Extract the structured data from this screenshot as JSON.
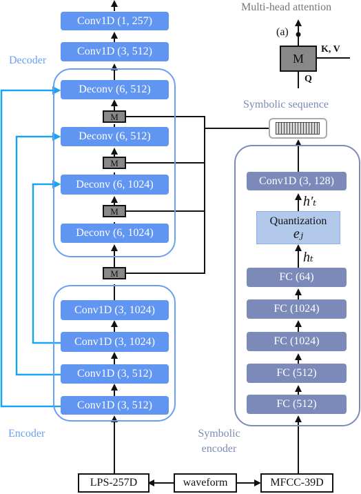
{
  "title": "Multi-head attention",
  "legend": {
    "title": "Multi-head attention",
    "label_a": "(a)",
    "m_label": "M",
    "kv_label": "K, V",
    "q_label": "Q"
  },
  "decoder": {
    "label": "Decoder",
    "top_layers": [
      "Conv1D (1, 257)",
      "Conv1D (3, 512)"
    ],
    "deconv_layers": [
      "Deconv (6, 512)",
      "Deconv (6, 512)",
      "Deconv (6, 1024)",
      "Deconv (6, 1024)"
    ]
  },
  "attention_block_label": "M",
  "encoder": {
    "label": "Encoder",
    "layers": [
      "Conv1D (3, 1024)",
      "Conv1D (3, 1024)",
      "Conv1D (3, 512)",
      "Conv1D (3, 512)"
    ]
  },
  "symbolic_sequence": {
    "label": "Symbolic sequence"
  },
  "symbolic_encoder": {
    "label_line1": "Symbolic",
    "label_line2": "encoder",
    "conv": "Conv1D (3, 128)",
    "h_prime": "h′ₜ",
    "quantization": "Quantization",
    "codebook": "eⱼ",
    "h": "hₜ",
    "fc_layers": [
      "FC (64)",
      "FC (1024)",
      "FC (1024)",
      "FC (512)",
      "FC (512)"
    ]
  },
  "inputs": {
    "lps": "LPS-257D",
    "waveform": "waveform",
    "mfcc": "MFCC-39D"
  },
  "colors": {
    "decoder_block": "#6195f2",
    "symbolic_block": "#7b8ab8",
    "quantization_block": "#b3c9ec",
    "skip_connection": "#1aa3f0"
  }
}
